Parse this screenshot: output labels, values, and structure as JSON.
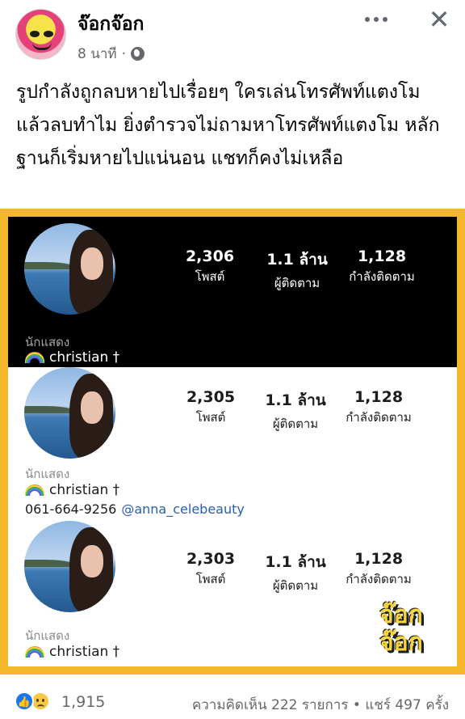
{
  "post": {
    "page_name": "จ๊อกจ๊อก",
    "time": "8 นาที",
    "dot": "·",
    "text": "รูปกำลังถูกลบหายไปเรื่อยๆ ใครเล่นโทรศัพท์แตงโม แล้วลบทำไม ยิ่งตำรวจไม่ถามหาโทรศัพท์แตงโม หลักฐานก็เริ่มหายไปแน่นอน แชทก็คงไม่เหลือ"
  },
  "icons": {
    "avatar": "page-avatar",
    "globe": "globe-icon",
    "more": "more-icon",
    "close": "close-icon",
    "close_glyph": "✕",
    "like": "like-reaction-icon",
    "like_glyph": "👍",
    "sad": "sad-reaction-icon",
    "rainbow": "rainbow-emoji-icon"
  },
  "screenshots": [
    {
      "posts": "2,306",
      "posts_label": "โพสต์",
      "followers": "1.1 ล้าน",
      "followers_label": "ผู้ติดตาม",
      "following": "1,128",
      "following_label": "กำลังติดตาม",
      "category": "นักแสดง",
      "name": "christian †"
    },
    {
      "posts": "2,305",
      "posts_label": "โพสต์",
      "followers": "1.1 ล้าน",
      "followers_label": "ผู้ติดตาม",
      "following": "1,128",
      "following_label": "กำลังติดตาม",
      "category": "นักแสดง",
      "name": "christian †",
      "phone": "061-664-9256",
      "tag": "@anna_celebeauty"
    },
    {
      "posts": "2,303",
      "posts_label": "โพสต์",
      "followers": "1.1 ล้าน",
      "followers_label": "ผู้ติดตาม",
      "following": "1,128",
      "following_label": "กำลังติดตาม",
      "category": "นักแสดง",
      "name": "christian †"
    }
  ],
  "watermark": {
    "line1": "จ๊อก",
    "line2": "จ๊อก"
  },
  "footer": {
    "reaction_count": "1,915",
    "comments": "ความคิดเห็น 222 รายการ",
    "separator": "•",
    "shares": "แชร์ 497 ครั้ง"
  },
  "colors": {
    "frame": "#f4b62a",
    "link": "#2a5db0",
    "like": "#1877f2"
  }
}
